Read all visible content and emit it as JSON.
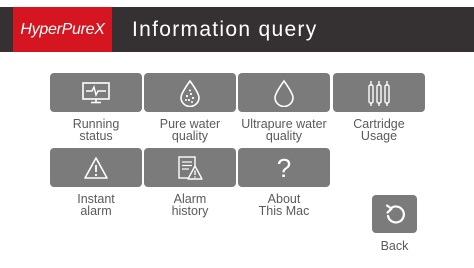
{
  "header": {
    "brand": "HyperPureX",
    "title": "Information query"
  },
  "menu": {
    "running_status": [
      "Running",
      "status"
    ],
    "pure_water_quality": [
      "Pure water",
      "quality"
    ],
    "ultrapure_water_quality": [
      "Ultrapure water",
      "quality"
    ],
    "cartridge_usage": [
      "Cartridge",
      "Usage"
    ],
    "instant_alarm": [
      "Instant",
      "alarm"
    ],
    "alarm_history": [
      "Alarm",
      "history"
    ],
    "about_this_mac": [
      "About",
      "This Mac"
    ]
  },
  "back": {
    "label": "Back"
  },
  "colors": {
    "header_bg": "#353132",
    "brand_bg": "#d5151f",
    "tile_bg": "#7b7b7b",
    "label_text": "#5a5a5a"
  },
  "icons": {
    "running_status": "monitor-waveform-icon",
    "pure_water_quality": "water-drop-dots-icon",
    "ultrapure_water_quality": "water-drop-icon",
    "cartridge_usage": "cartridges-icon",
    "instant_alarm": "warning-triangle-icon",
    "alarm_history": "document-warning-icon",
    "about_this_mac": "question-mark-icon",
    "back": "back-arrow-icon"
  }
}
